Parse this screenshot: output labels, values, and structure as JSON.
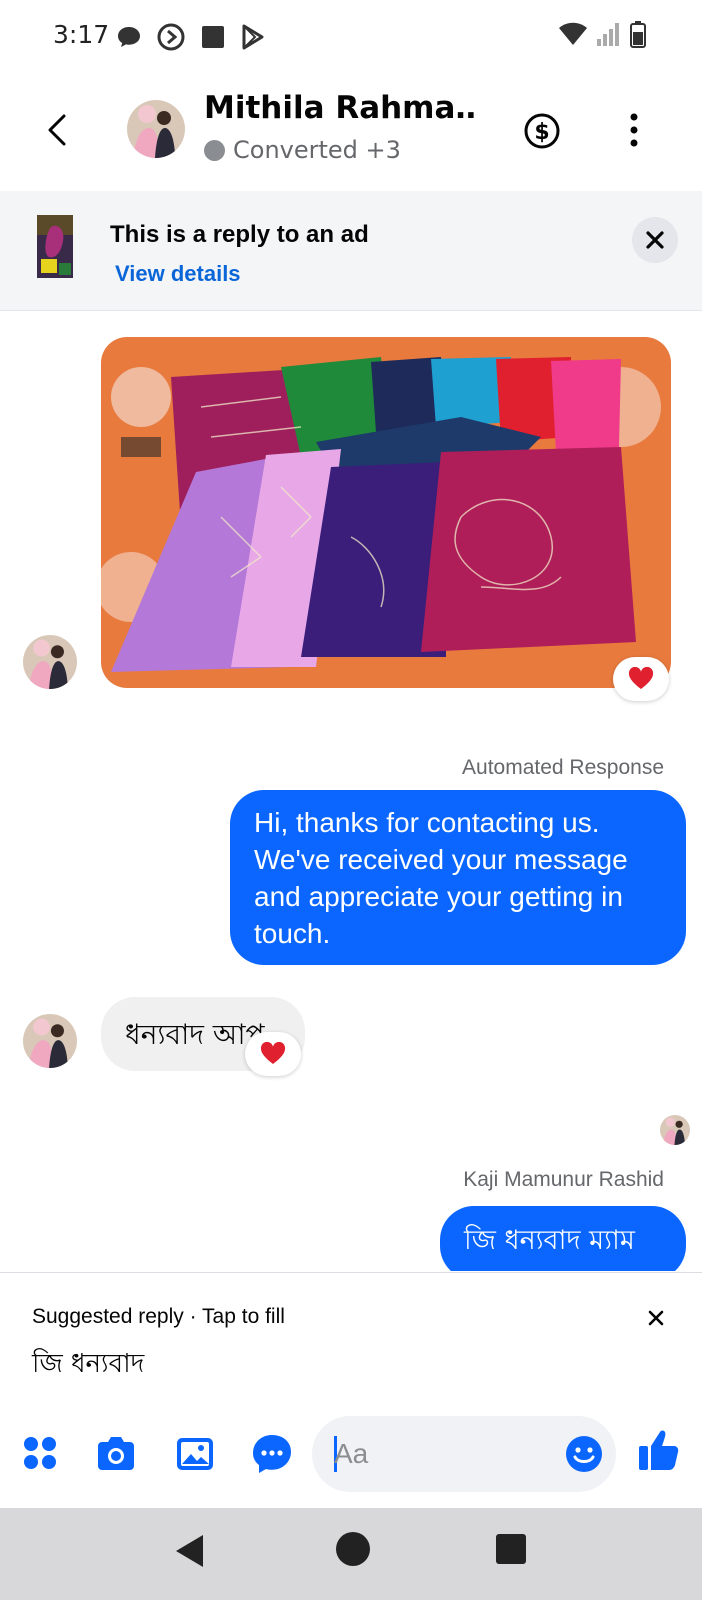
{
  "status_bar": {
    "time": "3:17"
  },
  "header": {
    "name": "Mithila Rahma…",
    "status": "Converted +3"
  },
  "ad_banner": {
    "title": "This is a reply to an ad",
    "link": "View details"
  },
  "messages": {
    "automated_label": "Automated Response",
    "automated_text": "Hi, thanks for contacting us. We've received your message and appreciate your getting in touch.",
    "incoming_text": "ধন্যবাদ আপু",
    "sender_label": "Kaji Mamunur Rashid",
    "outgoing_text": "জি ধন্যবাদ ম্যাম"
  },
  "suggested_reply": {
    "label": "Suggested reply · Tap to fill",
    "text": "জি ধন্যবাদ"
  },
  "composer": {
    "placeholder": "Aa"
  },
  "colors": {
    "accent": "#0a66ff",
    "link": "#0a66d8",
    "reaction_heart": "#e0202e",
    "status_dot": "#8a8d91"
  },
  "icons": {
    "back": "chevron-left-icon",
    "payment": "dollar-circle-icon",
    "more": "more-vertical-icon",
    "close": "close-icon",
    "reaction": "heart-icon",
    "apps": "apps-grid-icon",
    "camera": "camera-icon",
    "gallery": "image-icon",
    "chat": "chat-bubble-icon",
    "emoji": "emoji-icon",
    "like": "thumbs-up-icon"
  }
}
